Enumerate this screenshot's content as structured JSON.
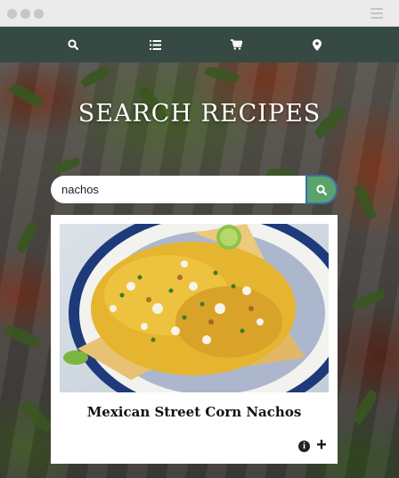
{
  "nav": {
    "items": [
      {
        "icon": "search-icon"
      },
      {
        "icon": "list-icon"
      },
      {
        "icon": "cart-icon"
      },
      {
        "icon": "location-icon"
      }
    ],
    "background": "#364943"
  },
  "hero": {
    "title": "SEARCH RECIPES"
  },
  "search": {
    "value": "nachos",
    "button_color": "#5aa36d"
  },
  "results": [
    {
      "title": "Mexican Street Corn Nachos",
      "info_label": "i",
      "add_label": "+"
    }
  ]
}
